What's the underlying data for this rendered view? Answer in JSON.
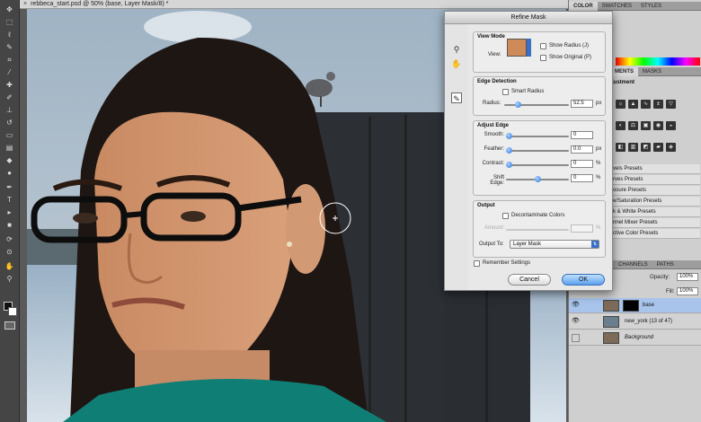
{
  "document": {
    "tab_title": "rebbeca_start.psd @ 50% (base, Layer Mask/8) *",
    "close_glyph": "×"
  },
  "toolbar": {
    "tools": [
      "move",
      "marquee",
      "lasso",
      "quick-select",
      "crop",
      "eyedropper",
      "healing",
      "brush",
      "clone",
      "history-brush",
      "eraser",
      "gradient",
      "blur",
      "dodge",
      "pen",
      "type",
      "path-select",
      "shape",
      "3d-rotate",
      "3d-orbit",
      "hand",
      "zoom"
    ]
  },
  "refine_mask": {
    "title": "Refine Mask",
    "view_mode": {
      "section": "View Mode",
      "view_label": "View:",
      "show_radius": "Show Radius (J)",
      "show_original": "Show Original (P)"
    },
    "edge_detection": {
      "section": "Edge Detection",
      "smart_radius": "Smart Radius",
      "radius_label": "Radius:",
      "radius_value": "52.5",
      "radius_unit": "px",
      "radius_fraction": 0.21
    },
    "adjust_edge": {
      "section": "Adjust Edge",
      "rows": [
        {
          "label": "Smooth:",
          "value": "0",
          "unit": "",
          "fraction": 0.0
        },
        {
          "label": "Feather:",
          "value": "0.0",
          "unit": "px",
          "fraction": 0.0
        },
        {
          "label": "Contrast:",
          "value": "0",
          "unit": "%",
          "fraction": 0.0
        },
        {
          "label": "Shift Edge:",
          "value": "0",
          "unit": "%",
          "fraction": 0.5
        }
      ]
    },
    "output": {
      "section": "Output",
      "decontaminate": "Decontaminate Colors",
      "amount_label": "Amount:",
      "amount_unit": "%",
      "output_to_label": "Output To:",
      "output_to_value": "Layer Mask"
    },
    "remember_settings": "Remember Settings",
    "cancel": "Cancel",
    "ok": "OK"
  },
  "panels": {
    "top_tabs": [
      "COLOR",
      "SWATCHES",
      "STYLES"
    ],
    "mid_tabs": [
      "MENTS",
      "MASKS"
    ],
    "adjustments_title": "justment",
    "presets": [
      "vels Presets",
      "rves Presets",
      "osure Presets",
      "e/Saturation Presets",
      "k & White Presets",
      "nnel Mixer Presets",
      "ctive Color Presets"
    ],
    "layer_tabs": [
      "CHANNELS",
      "PATHS"
    ],
    "opacity_label": "Opacity:",
    "opacity_value": "100%",
    "fill_label": "Fill:",
    "fill_value": "100%",
    "layers": [
      {
        "name": "base",
        "selected": true,
        "has_mask": true,
        "visible": true
      },
      {
        "name": "new_york (13 of 47)",
        "selected": false,
        "has_mask": false,
        "visible": true
      },
      {
        "name": "Background",
        "selected": false,
        "has_mask": false,
        "visible": false
      }
    ]
  },
  "colors": {
    "accent": "#3a7fd9",
    "selected_layer": "#a8c4ea",
    "dialog_bg": "#e8e8e8"
  }
}
